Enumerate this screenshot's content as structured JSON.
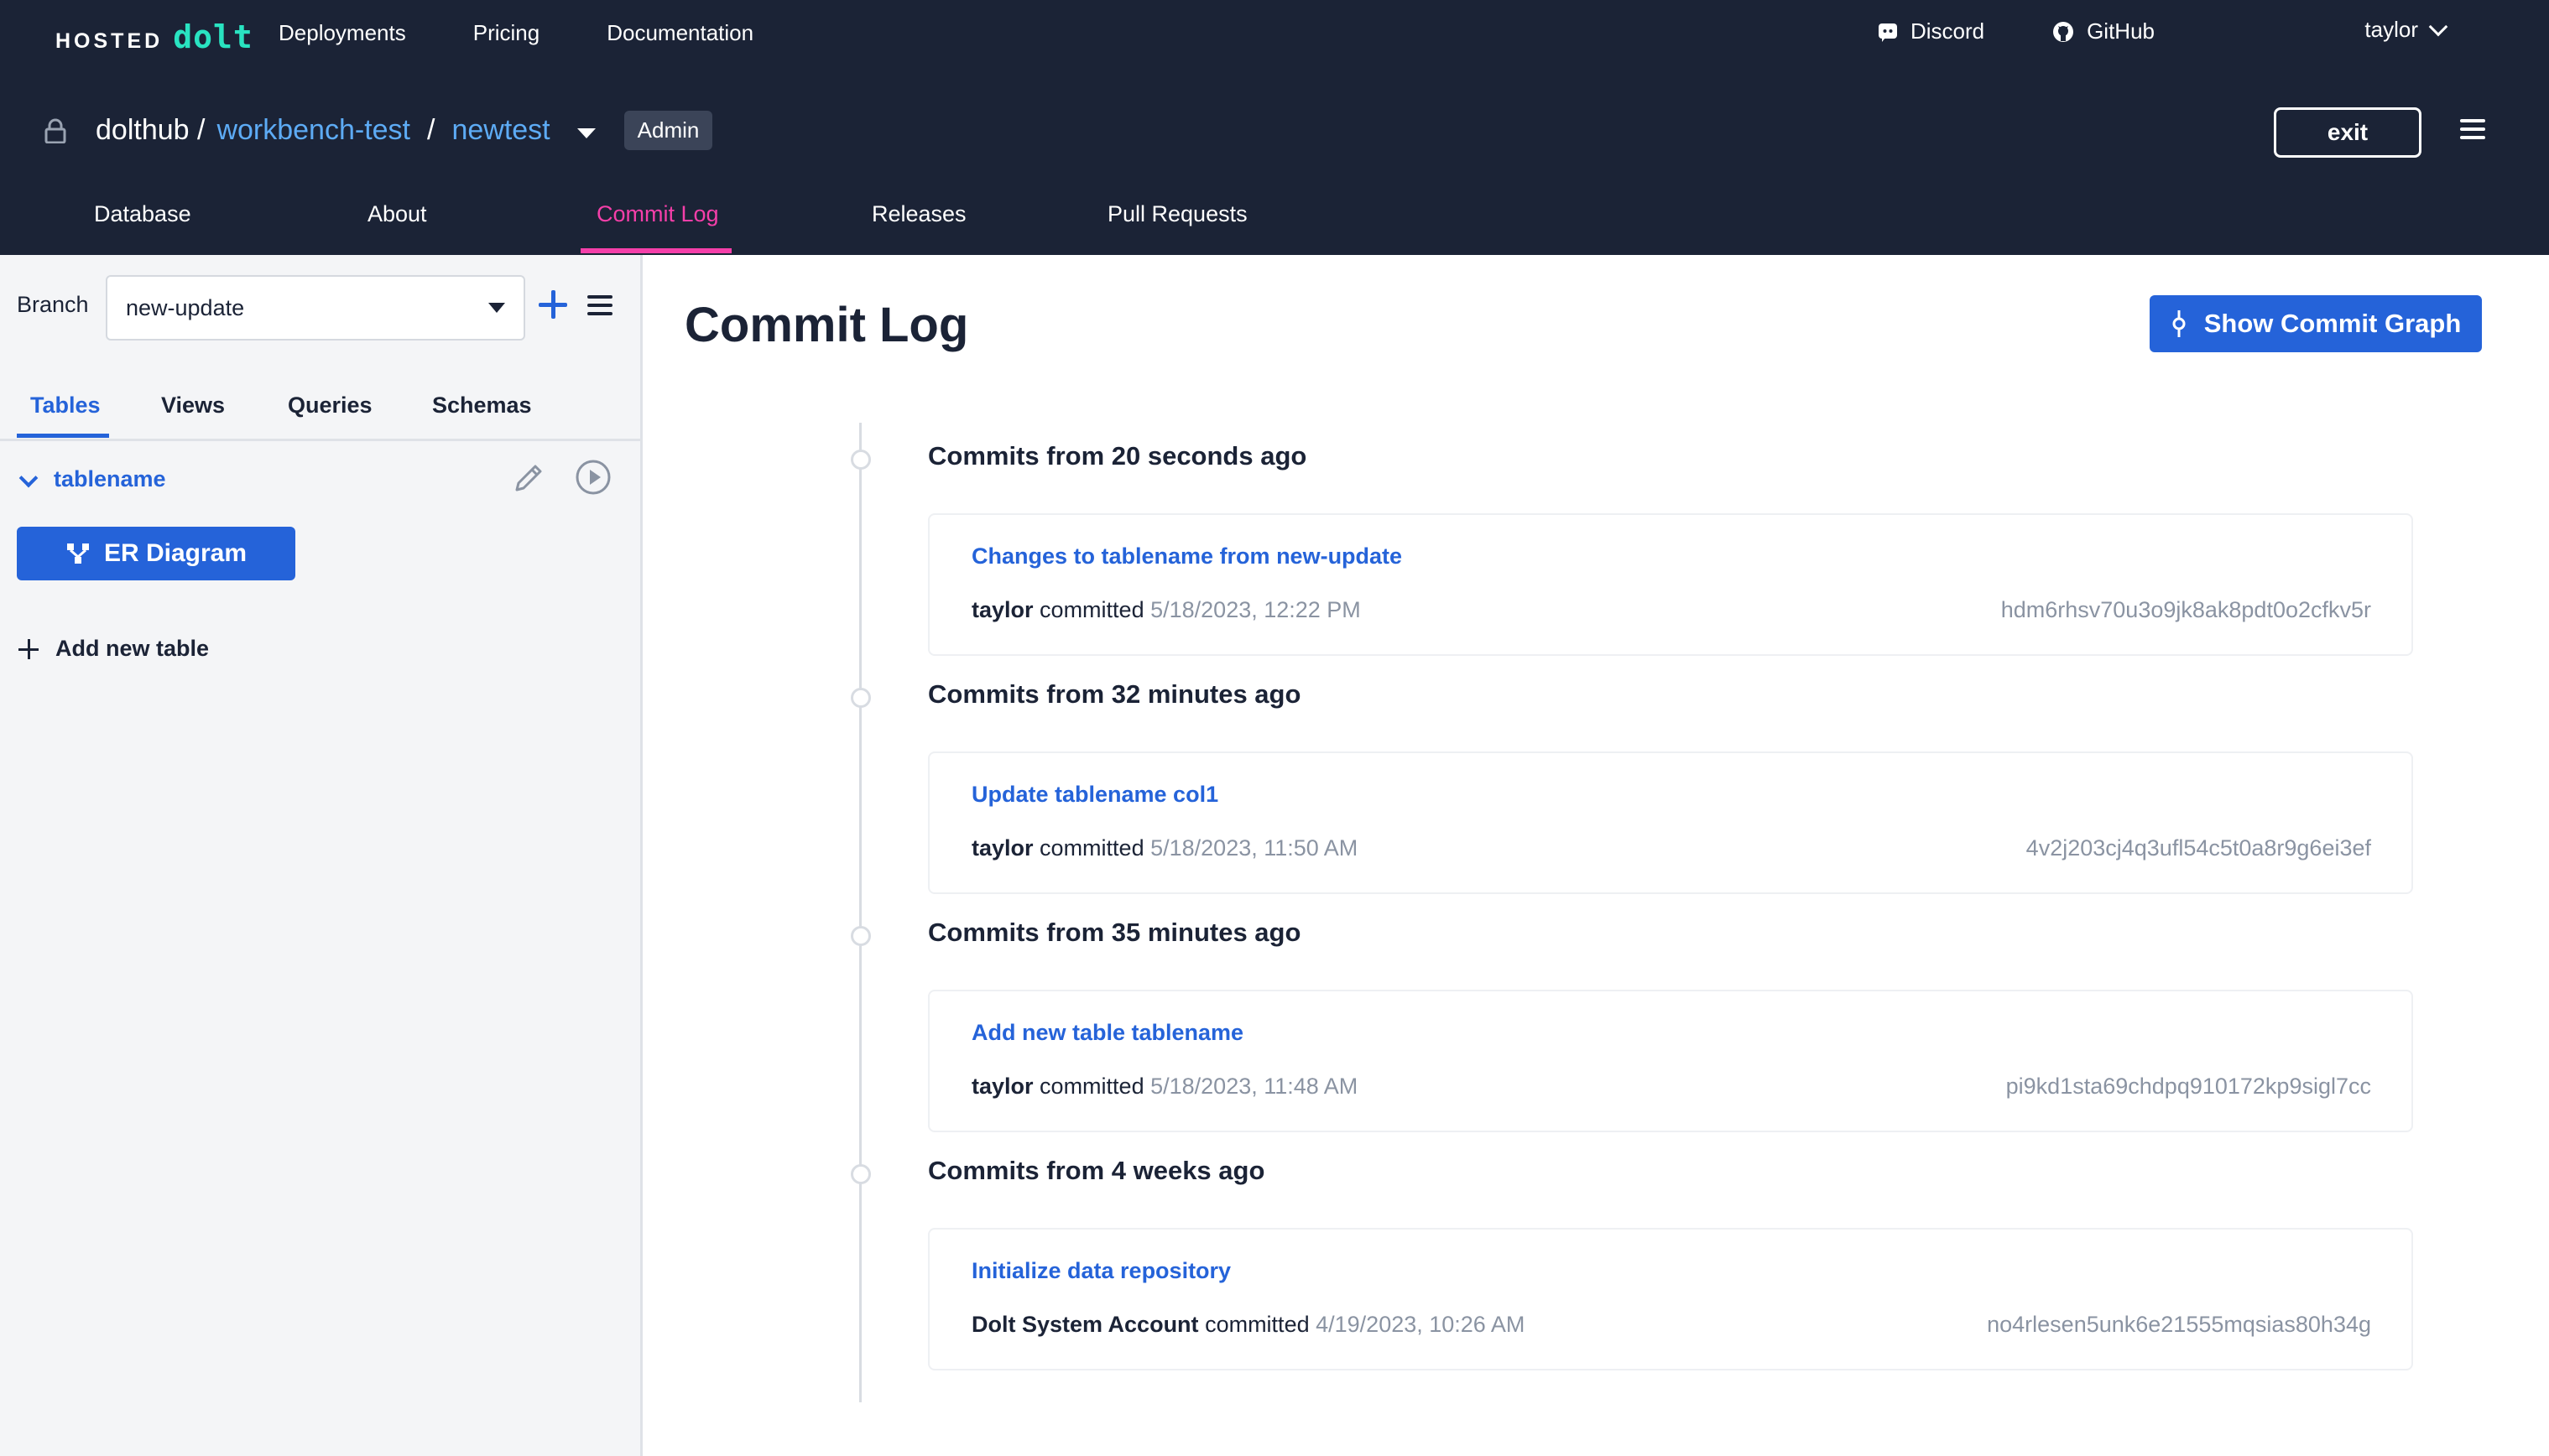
{
  "header": {
    "logo_hosted": "HOSTED",
    "logo_dolt": "dolt",
    "nav": [
      "Deployments",
      "Pricing",
      "Documentation"
    ],
    "discord": "Discord",
    "github": "GitHub",
    "user": "taylor",
    "breadcrumb": {
      "owner": "dolthub /",
      "deployment": "workbench-test",
      "separator": "/",
      "database": "newtest",
      "role_badge": "Admin"
    },
    "exit_label": "exit",
    "tabs": [
      "Database",
      "About",
      "Commit Log",
      "Releases",
      "Pull Requests"
    ],
    "active_tab": "Commit Log"
  },
  "sidebar": {
    "branch_label": "Branch",
    "branch_value": "new-update",
    "subtabs": [
      "Tables",
      "Views",
      "Queries",
      "Schemas"
    ],
    "active_subtab": "Tables",
    "tables": [
      {
        "name": "tablename"
      }
    ],
    "er_diagram_label": "ER Diagram",
    "add_table_label": "Add new table"
  },
  "main": {
    "title": "Commit Log",
    "graph_button_label": "Show Commit Graph",
    "groups": [
      {
        "title": "Commits from 20 seconds ago",
        "commit": {
          "message": "Changes to tablename from new-update",
          "author": "taylor",
          "verb": "committed",
          "date": "5/18/2023, 12:22 PM",
          "hash": "hdm6rhsv70u3o9jk8ak8pdt0o2cfkv5r"
        }
      },
      {
        "title": "Commits from 32 minutes ago",
        "commit": {
          "message": "Update tablename col1",
          "author": "taylor",
          "verb": "committed",
          "date": "5/18/2023, 11:50 AM",
          "hash": "4v2j203cj4q3ufl54c5t0a8r9g6ei3ef"
        }
      },
      {
        "title": "Commits from 35 minutes ago",
        "commit": {
          "message": "Add new table tablename",
          "author": "taylor",
          "verb": "committed",
          "date": "5/18/2023, 11:48 AM",
          "hash": "pi9kd1sta69chdpq910172kp9sigl7cc"
        }
      },
      {
        "title": "Commits from 4 weeks ago",
        "commit": {
          "message": "Initialize data repository",
          "author": "Dolt System Account",
          "verb": "committed",
          "date": "4/19/2023, 10:26 AM",
          "hash": "no4rlesen5unk6e21555mqsias80h34g"
        }
      }
    ]
  },
  "colors": {
    "header_bg": "#1b2336",
    "accent_blue": "#2563d9",
    "link_blue": "#5dabf5",
    "active_tab_pink": "#f53fa9",
    "dolt_green": "#29e3c1"
  }
}
